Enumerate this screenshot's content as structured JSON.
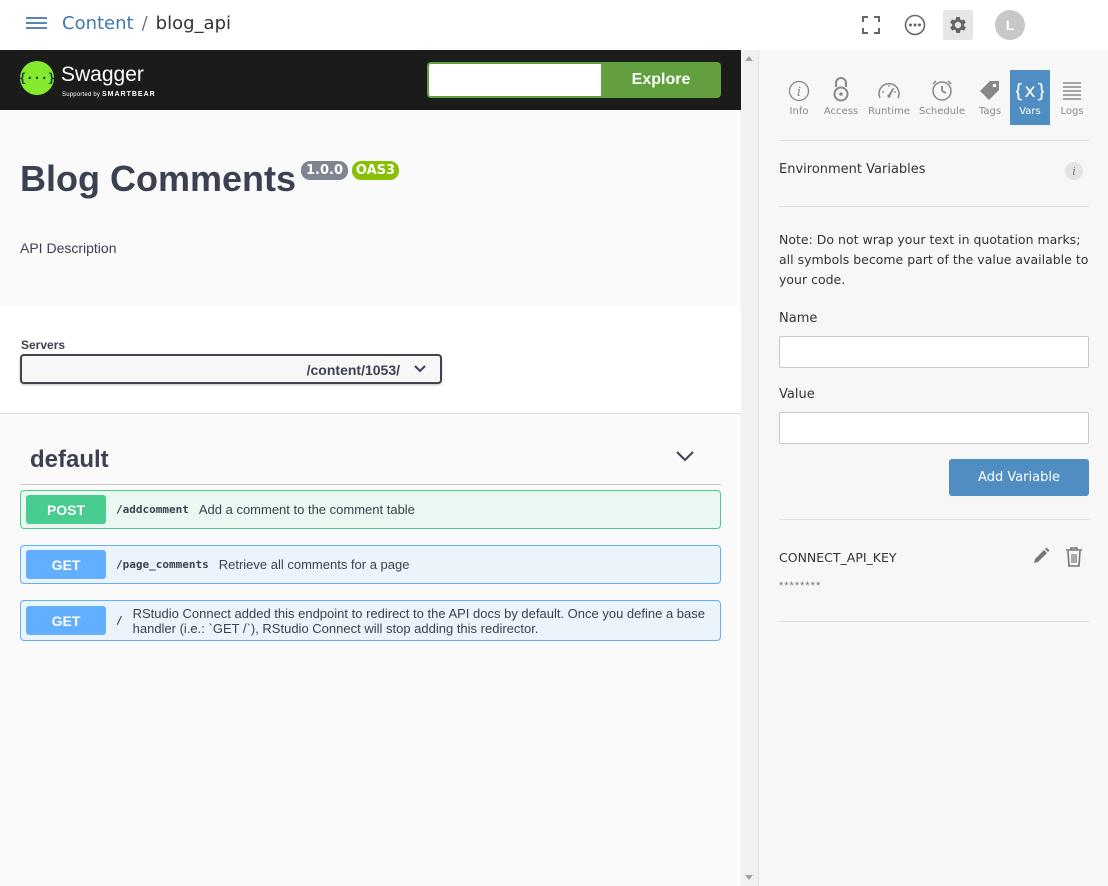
{
  "topbar": {
    "breadcrumb_root": "Content",
    "breadcrumb_sep": "/",
    "breadcrumb_current": "blog_api",
    "avatar_initial": "L",
    "icons": [
      "menu-icon",
      "fullscreen-icon",
      "more-icon",
      "gear-icon",
      "avatar"
    ]
  },
  "swagger": {
    "brand": "Swagger",
    "tagline_prefix": "Supported by",
    "tagline_brand": "SMARTBEAR",
    "logo_glyph": "{···}",
    "explore_label": "Explore",
    "url_value": "",
    "accent_color": "#62a03f"
  },
  "info": {
    "title": "Blog Comments",
    "version": "1.0.0",
    "oas": "OAS3",
    "description": "API Description"
  },
  "servers": {
    "label": "Servers",
    "selected": "/content/1053/"
  },
  "tag": {
    "name": "default"
  },
  "operations": [
    {
      "method": "POST",
      "path": "/addcomment",
      "summary": "Add a comment to the comment table"
    },
    {
      "method": "GET",
      "path": "/page_comments",
      "summary": "Retrieve all comments for a page"
    },
    {
      "method": "GET",
      "path": "/",
      "summary": "RStudio Connect added this endpoint to redirect to the API docs by default. Once you define a base handler (i.e.: `GET /`), RStudio Connect will stop adding this redirector."
    }
  ],
  "settings_tabs": [
    {
      "label": "Info",
      "icon": "info-icon"
    },
    {
      "label": "Access",
      "icon": "lock-icon"
    },
    {
      "label": "Runtime",
      "icon": "gauge-icon"
    },
    {
      "label": "Schedule",
      "icon": "clock-icon"
    },
    {
      "label": "Tags",
      "icon": "tag-icon"
    },
    {
      "label": "Vars",
      "icon": "variable-icon",
      "active": true
    },
    {
      "label": "Logs",
      "icon": "logs-icon"
    }
  ],
  "env": {
    "title": "Environment Variables",
    "info_glyph": "i",
    "note": "Note: Do not wrap your text in quotation marks; all symbols become part of the value available to your code.",
    "name_label": "Name",
    "name_value": "",
    "value_label": "Value",
    "value_value": "",
    "add_button": "Add Variable",
    "variables": [
      {
        "name": "CONNECT_API_KEY",
        "value": "********"
      }
    ]
  },
  "colors": {
    "post": "#49cc90",
    "get": "#61affe",
    "primary": "#4f8dc2"
  }
}
